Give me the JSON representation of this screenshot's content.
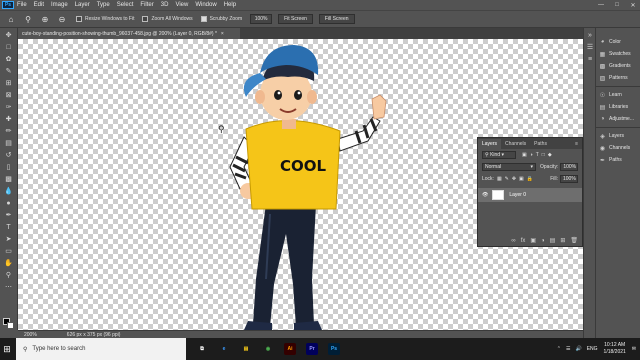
{
  "app": {
    "logo": "Ps",
    "name": "Adobe Photoshop"
  },
  "menu": [
    "File",
    "Edit",
    "Image",
    "Layer",
    "Type",
    "Select",
    "Filter",
    "3D",
    "View",
    "Window",
    "Help"
  ],
  "window_controls": [
    "minimize-icon",
    "maximize-icon",
    "close-icon"
  ],
  "options": {
    "tool_icon": "zoom-icon",
    "resize_windows_label": "Resize Windows to Fit",
    "zoom_all_windows_label": "Zoom All Windows",
    "scrubby_zoom_label": "Scrubby Zoom",
    "scrubby_zoom_checked": true,
    "zoom_value": "100%",
    "fit_screen_label": "Fit Screen",
    "fill_screen_label": "Fill Screen"
  },
  "document": {
    "tab_title": "cute-boy-standing-position-showing-thumb_96037-458.jpg @ 200% (Layer 0, RGB/8#) *",
    "close": "×"
  },
  "status": {
    "zoom": "200%",
    "doc_size": "626 px x 375 px (96 ppi)"
  },
  "right_panels": [
    {
      "label": "Color",
      "icon": "color-wheel-icon"
    },
    {
      "label": "Swatches",
      "icon": "grid-icon"
    },
    {
      "label": "Gradients",
      "icon": "gradient-icon"
    },
    {
      "label": "Patterns",
      "icon": "pattern-icon"
    },
    {
      "label": "Learn",
      "icon": "lightbulb-icon"
    },
    {
      "label": "Libraries",
      "icon": "library-icon"
    },
    {
      "label": "Adjustme...",
      "icon": "adjustment-icon"
    },
    {
      "label": "Layers",
      "icon": "layers-icon"
    },
    {
      "label": "Channels",
      "icon": "channels-icon"
    },
    {
      "label": "Paths",
      "icon": "paths-icon"
    }
  ],
  "layers_panel": {
    "tabs": [
      "Layers",
      "Channels",
      "Paths"
    ],
    "filter_kind": "Kind",
    "blend_mode": "Normal",
    "opacity_label": "Opacity:",
    "opacity_value": "100%",
    "lock_label": "Lock:",
    "fill_label": "Fill:",
    "fill_value": "100%",
    "layer_name": "Layer 0"
  },
  "taskbar": {
    "search_placeholder": "Type here to search",
    "apps": [
      {
        "name": "Ai",
        "color": "#ff9a00",
        "bg": "#330000"
      },
      {
        "name": "Pr",
        "color": "#9999ff",
        "bg": "#00005b"
      },
      {
        "name": "Ps",
        "color": "#31a8ff",
        "bg": "#001e36"
      }
    ],
    "time": "10:12 AM",
    "date": "1/18/2021",
    "lang": "ENG"
  }
}
